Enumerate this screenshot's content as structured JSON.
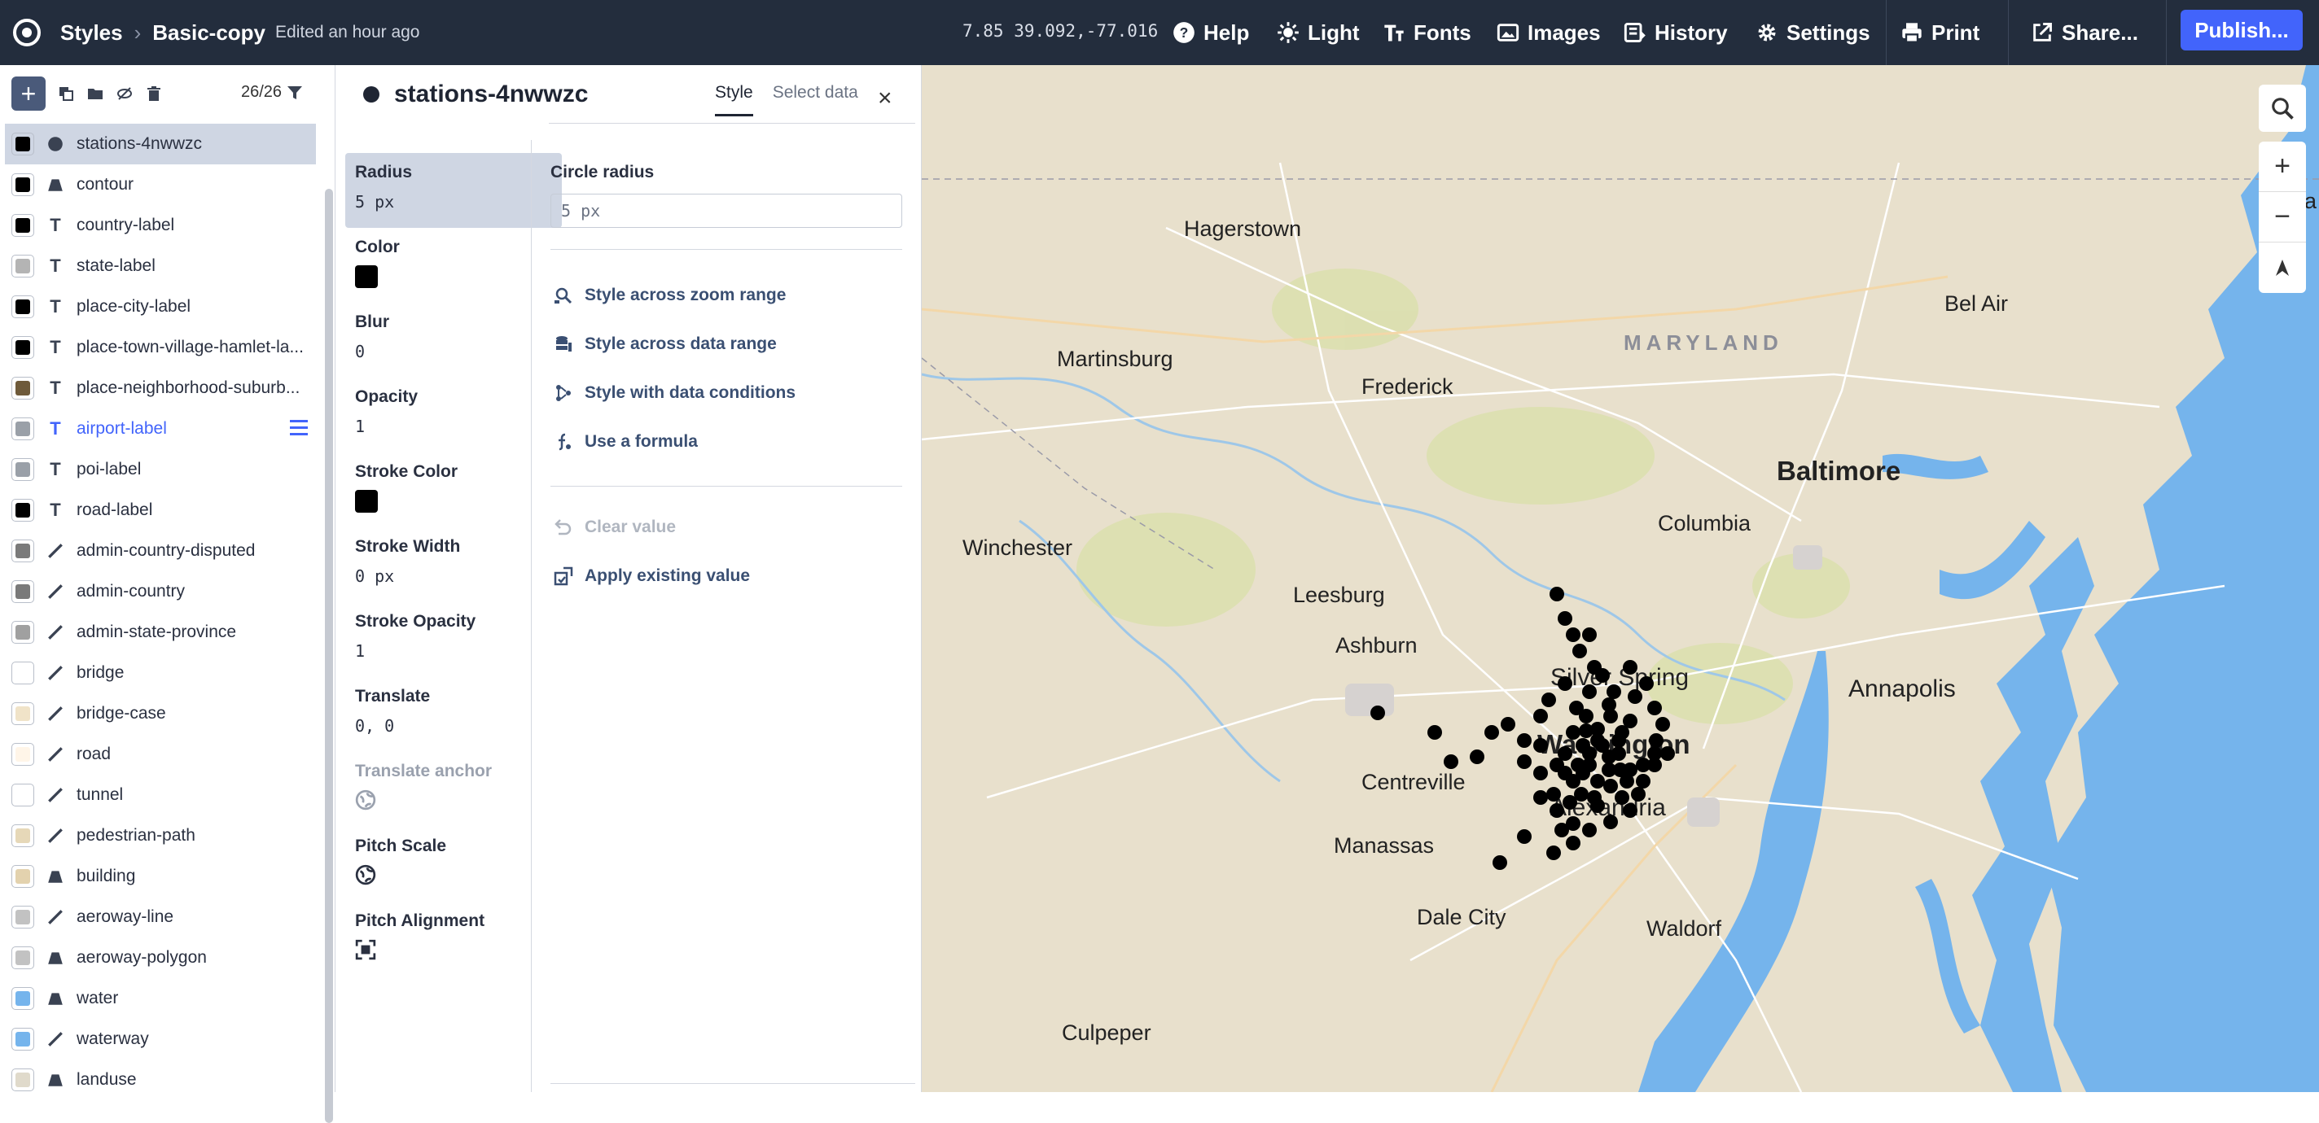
{
  "header": {
    "styles_label": "Styles",
    "style_name": "Basic-copy",
    "edited": "Edited an hour ago",
    "coords": "7.85 39.092,-77.016",
    "help": "Help",
    "light": "Light",
    "fonts": "Fonts",
    "images": "Images",
    "history": "History",
    "settings": "Settings",
    "print": "Print",
    "share": "Share...",
    "publish": "Publish..."
  },
  "layers_toolbar": {
    "count": "26/26"
  },
  "layers": [
    {
      "name": "stations-4nwwzc",
      "icon": "circle",
      "swatch": "#000000",
      "selected": true
    },
    {
      "name": "contour",
      "icon": "fill",
      "swatch": "#000000"
    },
    {
      "name": "country-label",
      "icon": "text",
      "swatch": "#000000"
    },
    {
      "name": "state-label",
      "icon": "text",
      "swatch": "#b4b4b4"
    },
    {
      "name": "place-city-label",
      "icon": "text",
      "swatch": "#000000"
    },
    {
      "name": "place-town-village-hamlet-la...",
      "icon": "text",
      "swatch": "#000000"
    },
    {
      "name": "place-neighborhood-suburb...",
      "icon": "text",
      "swatch": "#6e5a3a"
    },
    {
      "name": "airport-label",
      "icon": "text",
      "swatch": "#9aa0a8",
      "highlight": true
    },
    {
      "name": "poi-label",
      "icon": "text",
      "swatch": "#9aa0a8"
    },
    {
      "name": "road-label",
      "icon": "text",
      "swatch": "#000000"
    },
    {
      "name": "admin-country-disputed",
      "icon": "line",
      "swatch": "#7a7a7a"
    },
    {
      "name": "admin-country",
      "icon": "line",
      "swatch": "#7a7a7a"
    },
    {
      "name": "admin-state-province",
      "icon": "line",
      "swatch": "#a0a0a0"
    },
    {
      "name": "bridge",
      "icon": "line",
      "swatch": "#ffffff"
    },
    {
      "name": "bridge-case",
      "icon": "line",
      "swatch": "#f0e3c8"
    },
    {
      "name": "road",
      "icon": "line",
      "swatch": "#fff5e8"
    },
    {
      "name": "tunnel",
      "icon": "line",
      "swatch": "#ffffff"
    },
    {
      "name": "pedestrian-path",
      "icon": "line",
      "swatch": "#e6d8b8"
    },
    {
      "name": "building",
      "icon": "fill",
      "swatch": "#e3d2ae"
    },
    {
      "name": "aeroway-line",
      "icon": "line",
      "swatch": "#c2c2c2"
    },
    {
      "name": "aeroway-polygon",
      "icon": "fill",
      "swatch": "#c2c2c2"
    },
    {
      "name": "water",
      "icon": "fill",
      "swatch": "#75b4ec"
    },
    {
      "name": "waterway",
      "icon": "line",
      "swatch": "#75b4ec"
    },
    {
      "name": "landuse",
      "icon": "fill",
      "swatch": "#e0dacb"
    }
  ],
  "panel": {
    "layer_name": "stations-4nwwzc",
    "tab_style": "Style",
    "tab_select": "Select data",
    "props": [
      {
        "label": "Radius",
        "value": "5 px",
        "kind": "text"
      },
      {
        "label": "Color",
        "value": "",
        "kind": "swatch"
      },
      {
        "label": "Blur",
        "value": "0",
        "kind": "text"
      },
      {
        "label": "Opacity",
        "value": "1",
        "kind": "text"
      },
      {
        "label": "Stroke Color",
        "value": "",
        "kind": "swatch"
      },
      {
        "label": "Stroke Width",
        "value": "0 px",
        "kind": "text"
      },
      {
        "label": "Stroke Opacity",
        "value": "1",
        "kind": "text"
      },
      {
        "label": "Translate",
        "value": "0, 0",
        "kind": "text"
      },
      {
        "label": "Translate anchor",
        "value": "",
        "kind": "globe"
      },
      {
        "label": "Pitch Scale",
        "value": "",
        "kind": "globe"
      },
      {
        "label": "Pitch Alignment",
        "value": "",
        "kind": "frame"
      }
    ],
    "editor": {
      "label": "Circle radius",
      "value": "5  px",
      "opt_zoom": "Style across zoom range",
      "opt_data": "Style across data range",
      "opt_cond": "Style with data conditions",
      "opt_formula": "Use a formula",
      "clear": "Clear value",
      "apply": "Apply existing value"
    }
  },
  "map": {
    "labels": {
      "hagerstown": "Hagerstown",
      "belair": "Bel Air",
      "maryland": "MARYLAND",
      "martinsburg": "Martinsburg",
      "frederick": "Frederick",
      "baltimore": "Baltimore",
      "columbia": "Columbia",
      "winchester": "Winchester",
      "leesburg": "Leesburg",
      "ashburn": "Ashburn",
      "silverspring": "Silver Spring",
      "annapolis": "Annapolis",
      "washington": "Washington",
      "centreville": "Centreville",
      "alexandria": "Alexandria",
      "manassas": "Manassas",
      "dalecity": "Dale City",
      "waldorf": "Waldorf",
      "culpeper": "Culpeper"
    },
    "land_color": "#e8e0cc",
    "water_color": "#75b4ec",
    "marker_color": "#000000"
  }
}
